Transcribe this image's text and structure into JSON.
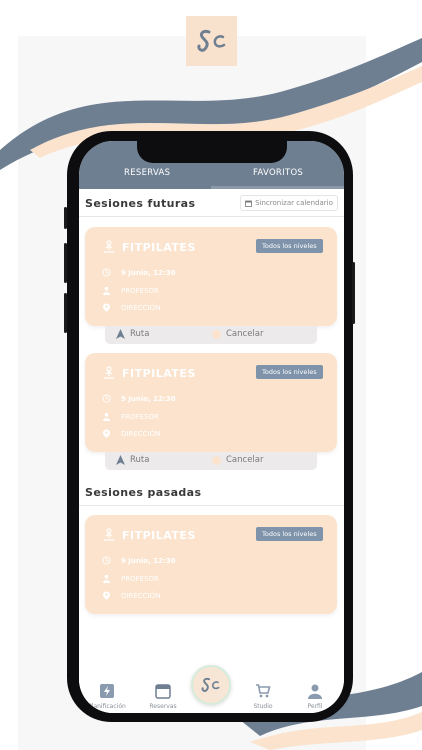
{
  "brand": {
    "logo_text": "Sc",
    "accent": "#6f7f92",
    "peach": "#fbe3cd"
  },
  "tabs": [
    {
      "label": "RESERVAS",
      "active": false
    },
    {
      "label": "FAVORITOS",
      "active": true
    }
  ],
  "futuras": {
    "title": "Sesiones futuras",
    "sync_label": "Sincronizar calendario",
    "cards": [
      {
        "title": "FITPILATES",
        "level": "Todos los niveles",
        "date": "9 Junio, 12:30",
        "teacher": "PROFESOR",
        "address": "DIRECCIÓN",
        "route": "Ruta",
        "cancel": "Cancelar"
      },
      {
        "title": "FITPILATES",
        "level": "Todos los niveles",
        "date": "9 Junio, 12:30",
        "teacher": "PROFESOR",
        "address": "DIRECCIÓN",
        "route": "Ruta",
        "cancel": "Cancelar"
      }
    ]
  },
  "pasadas": {
    "title": "Sesiones pasadas",
    "cards": [
      {
        "title": "FITPILATES",
        "level": "Todos los niveles",
        "date": "9 Junio, 12:30",
        "teacher": "PROFESOR",
        "address": "DIRECCIÓN"
      }
    ]
  },
  "nav": {
    "items": [
      {
        "label": "Planificación",
        "icon": "bolt-icon"
      },
      {
        "label": "Reservas",
        "icon": "calendar-icon"
      },
      {
        "label": "",
        "icon": "logo-icon"
      },
      {
        "label": "Studio",
        "icon": "cart-icon"
      },
      {
        "label": "Perfil",
        "icon": "user-icon"
      }
    ]
  }
}
